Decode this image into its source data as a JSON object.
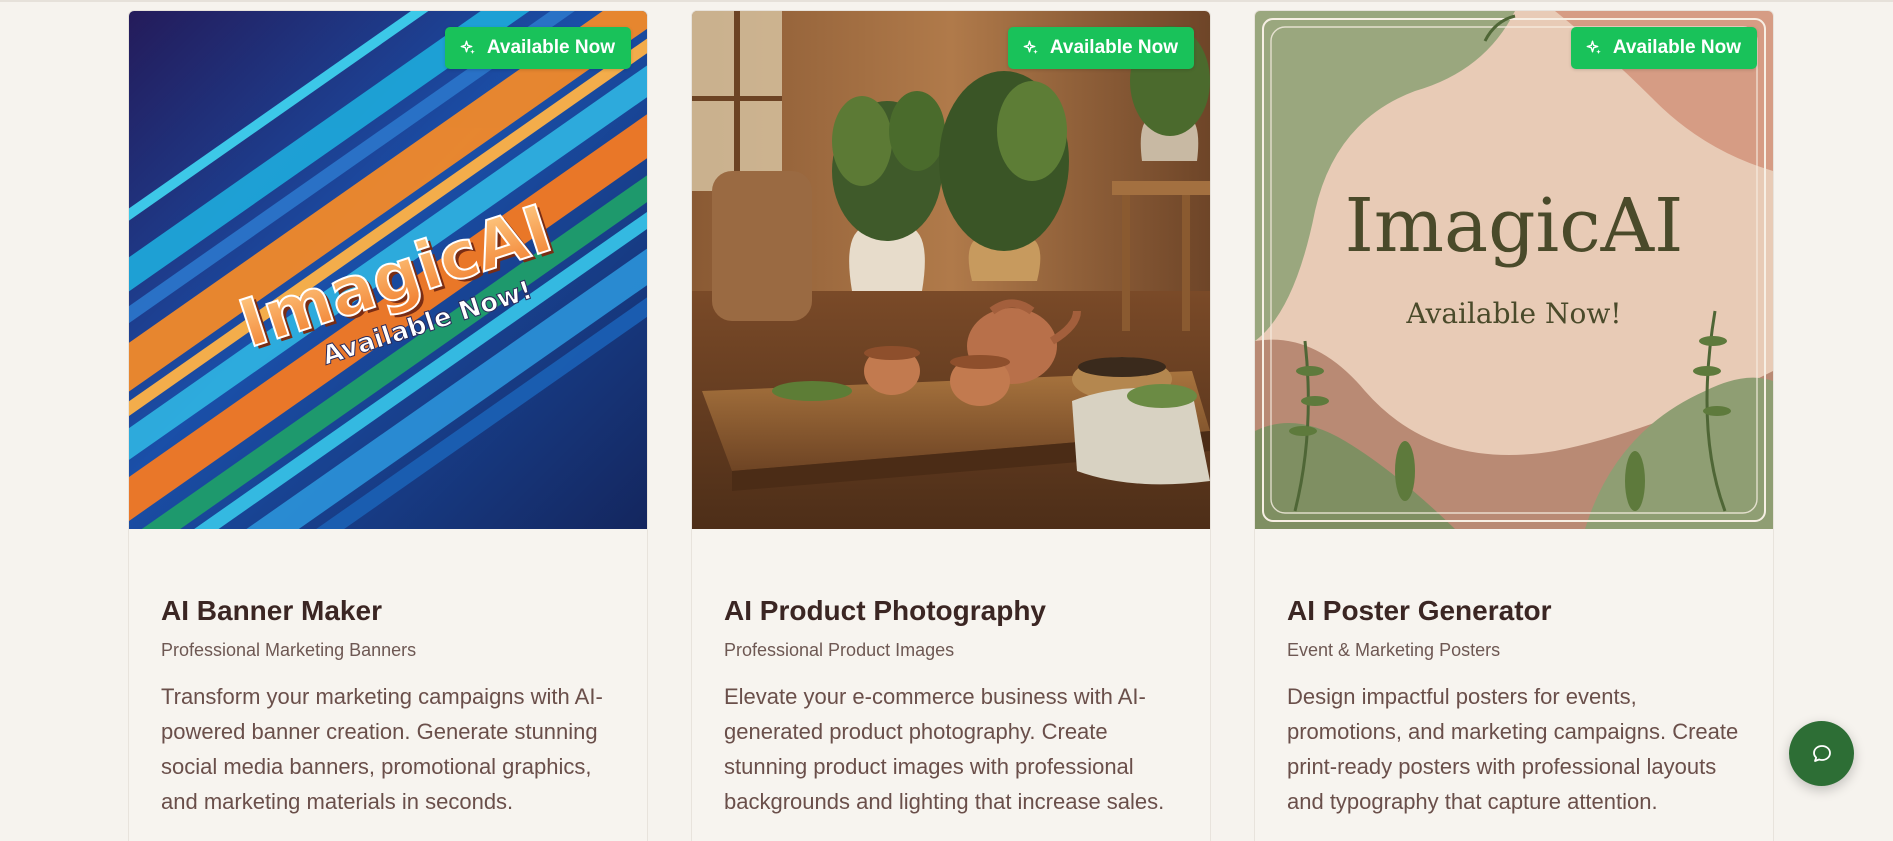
{
  "colors": {
    "page_background": "#f6f3ee",
    "badge_background": "#19c25a",
    "badge_text": "#ffffff",
    "title_text": "#3b2623",
    "body_text": "#6a4f4a",
    "chat_button": "#2d6e35"
  },
  "cards": [
    {
      "image_text": "ImagicAI",
      "image_subtext": "Available Now!",
      "badge": "Available Now",
      "badge_icon": "sparkle-icon",
      "title": "AI Banner Maker",
      "subtitle": "Professional Marketing Banners",
      "description": "Transform your marketing campaigns with AI-powered banner creation. Generate stunning social media banners, promotional graphics, and marketing materials in seconds."
    },
    {
      "badge": "Available Now",
      "badge_icon": "sparkle-icon",
      "title": "AI Product Photography",
      "subtitle": "Professional Product Images",
      "description": "Elevate your e-commerce business with AI-generated product photography. Create stunning product images with professional backgrounds and lighting that increase sales."
    },
    {
      "image_text": "ImagicAI",
      "image_subtext": "Available Now!",
      "badge": "Available Now",
      "badge_icon": "sparkle-icon",
      "title": "AI Poster Generator",
      "subtitle": "Event & Marketing Posters",
      "description": "Design impactful posters for events, promotions, and marketing campaigns. Create print-ready posters with professional layouts and typography that capture attention."
    }
  ],
  "chat": {
    "icon": "chat-bubble-icon"
  }
}
